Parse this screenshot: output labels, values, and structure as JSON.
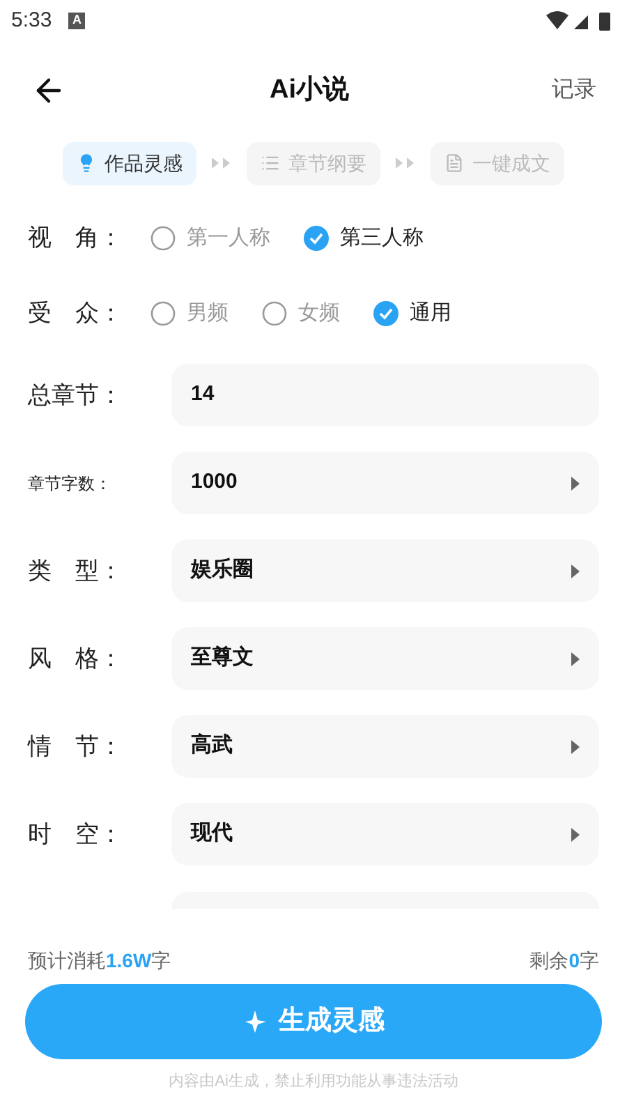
{
  "status_bar": {
    "time": "5:33",
    "notification": "A"
  },
  "header": {
    "title": "Ai小说",
    "action": "记录"
  },
  "steps": [
    {
      "label": "作品灵感",
      "selected": true,
      "kind": "bulb"
    },
    {
      "label": "章节纲要",
      "selected": false,
      "kind": "list"
    },
    {
      "label": "一键成文",
      "selected": false,
      "kind": "doc"
    }
  ],
  "form": [
    {
      "kind": "radio",
      "label": "视　角：",
      "options": [
        {
          "label": "第一人称",
          "selected": false
        },
        {
          "label": "第三人称",
          "selected": true
        }
      ]
    },
    {
      "kind": "radio",
      "label": "受　众：",
      "options": [
        {
          "label": "男频",
          "selected": false
        },
        {
          "label": "女频",
          "selected": false
        },
        {
          "label": "通用",
          "selected": true
        }
      ]
    },
    {
      "kind": "input",
      "label": "总章节：",
      "value": "14"
    },
    {
      "kind": "select",
      "label": "章节字数：",
      "small": true,
      "value": "1000"
    },
    {
      "kind": "select",
      "label": "类　型：",
      "value": "娱乐圈"
    },
    {
      "kind": "select",
      "label": "风　格：",
      "value": "至尊文"
    },
    {
      "kind": "select",
      "label": "情　节：",
      "value": "高武"
    },
    {
      "kind": "select",
      "label": "时　空：",
      "value": "现代"
    }
  ],
  "cost": {
    "prefix": "预计消耗",
    "amount": "1.6W",
    "suffix": "字"
  },
  "remaining": {
    "prefix": "剩余",
    "amount": "0",
    "suffix": "字"
  },
  "generate_button": "生成灵感",
  "disclaimer": "内容由Ai生成，禁止利用功能从事违法活动"
}
